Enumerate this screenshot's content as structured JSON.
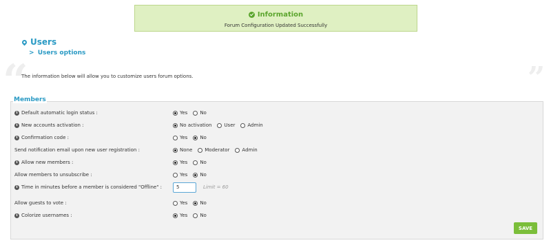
{
  "alert": {
    "title": "Information",
    "message": "Forum Configuration Updated Successfully"
  },
  "header": {
    "title": "Users",
    "subtitle_arrow": ">",
    "subtitle": "Users options"
  },
  "intro": "The information below will allow you to customize users forum options.",
  "fieldset": {
    "legend": "Members"
  },
  "fields": [
    {
      "label": "Default automatic login status :",
      "has_info": true,
      "options": [
        {
          "label": "Yes",
          "checked": true
        },
        {
          "label": "No",
          "checked": false
        }
      ]
    },
    {
      "label": "New accounts activation :",
      "has_info": true,
      "options": [
        {
          "label": "No activation",
          "checked": true
        },
        {
          "label": "User",
          "checked": false
        },
        {
          "label": "Admin",
          "checked": false
        }
      ]
    },
    {
      "label": "Confirmation code :",
      "has_info": true,
      "options": [
        {
          "label": "Yes",
          "checked": false
        },
        {
          "label": "No",
          "checked": true
        }
      ]
    },
    {
      "label": "Send notification email upon new user registration :",
      "has_info": false,
      "options": [
        {
          "label": "None",
          "checked": true
        },
        {
          "label": "Moderator",
          "checked": false
        },
        {
          "label": "Admin",
          "checked": false
        }
      ]
    },
    {
      "label": "Allow new members :",
      "has_info": true,
      "options": [
        {
          "label": "Yes",
          "checked": true
        },
        {
          "label": "No",
          "checked": false
        }
      ]
    },
    {
      "label": "Allow members to unsubscribe :",
      "has_info": false,
      "options": [
        {
          "label": "Yes",
          "checked": false
        },
        {
          "label": "No",
          "checked": true
        }
      ]
    },
    {
      "label": "Time in minutes before a member is considered \"Offline\" :",
      "has_info": true,
      "input_value": "5",
      "limit": "Limit = 60"
    },
    {
      "label": "Allow guests to vote :",
      "has_info": false,
      "options": [
        {
          "label": "Yes",
          "checked": false
        },
        {
          "label": "No",
          "checked": true
        }
      ]
    },
    {
      "label": "Colorize usernames :",
      "has_info": true,
      "options": [
        {
          "label": "Yes",
          "checked": true
        },
        {
          "label": "No",
          "checked": false
        }
      ]
    }
  ],
  "save_label": "SAVE",
  "icons": {
    "alert": "check-circle-icon",
    "title": "map-marker-icon",
    "info": "info-circle-icon"
  },
  "colors": {
    "accent": "#2a9ac4",
    "success": "#5ba52d",
    "alert_bg": "#dff0c2",
    "save_button": "#7bbe3a"
  }
}
